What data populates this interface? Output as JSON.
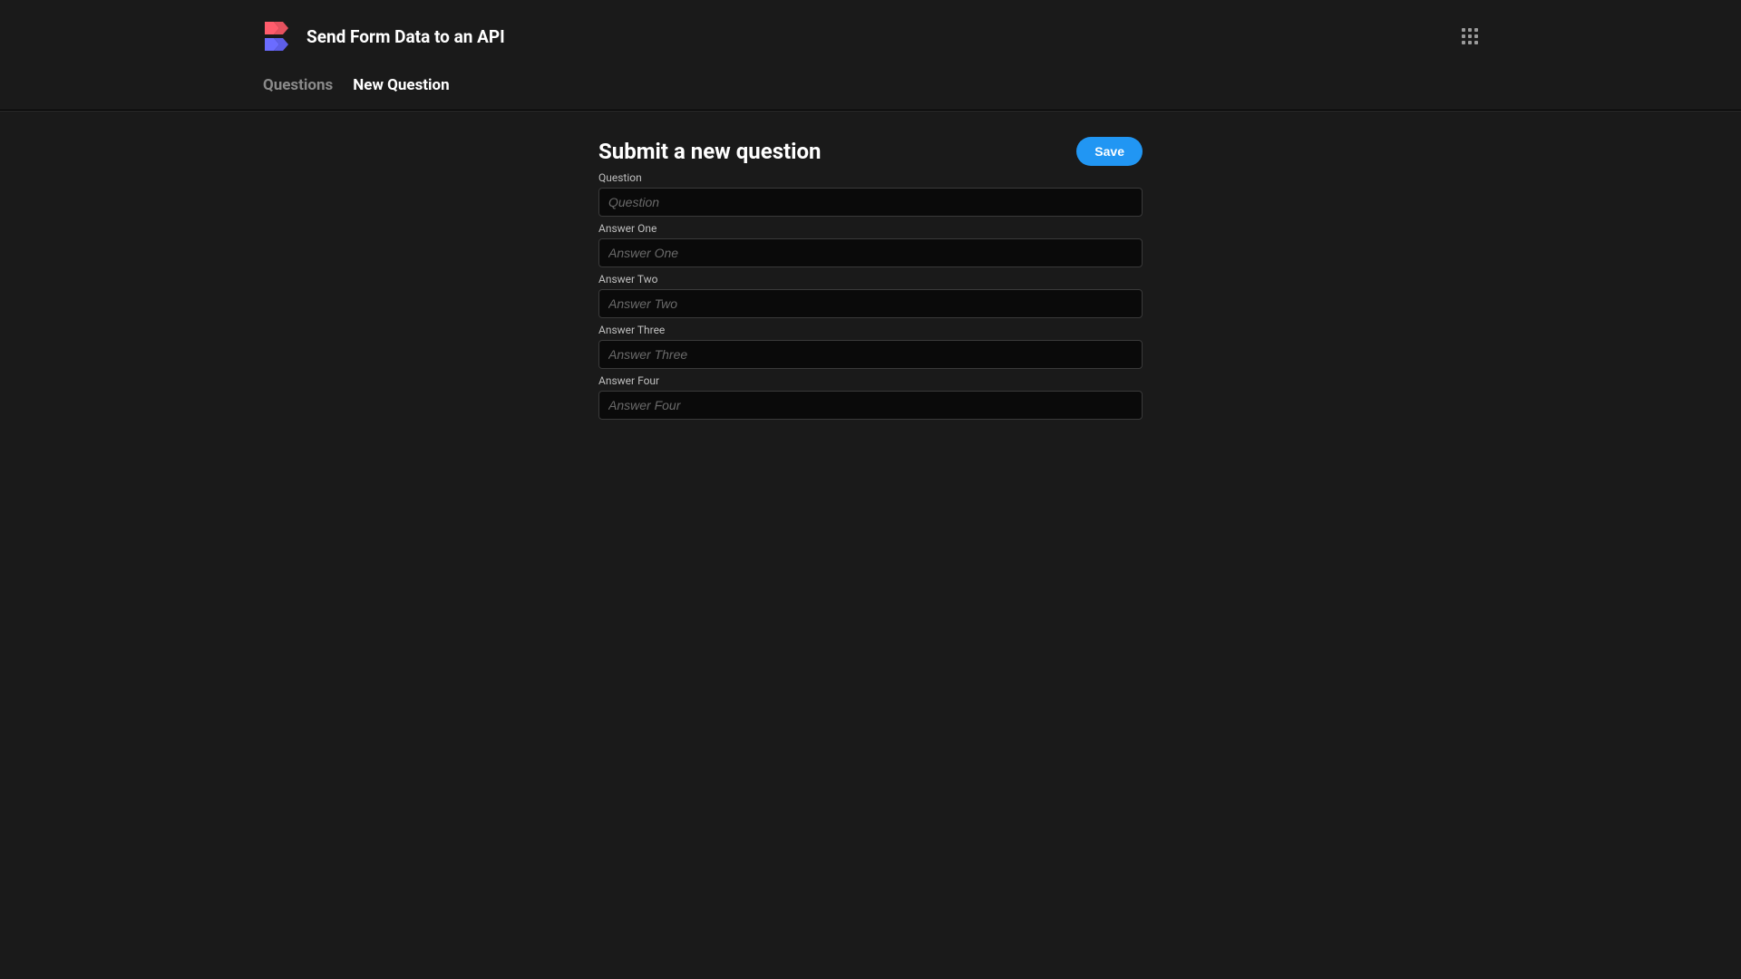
{
  "header": {
    "title": "Send Form Data to an API"
  },
  "tabs": {
    "questions": "Questions",
    "new_question": "New Question"
  },
  "form": {
    "title": "Submit a new question",
    "save_label": "Save",
    "fields": {
      "question": {
        "label": "Question",
        "placeholder": "Question"
      },
      "answer_one": {
        "label": "Answer One",
        "placeholder": "Answer One"
      },
      "answer_two": {
        "label": "Answer Two",
        "placeholder": "Answer Two"
      },
      "answer_three": {
        "label": "Answer Three",
        "placeholder": "Answer Three"
      },
      "answer_four": {
        "label": "Answer Four",
        "placeholder": "Answer Four"
      }
    }
  }
}
